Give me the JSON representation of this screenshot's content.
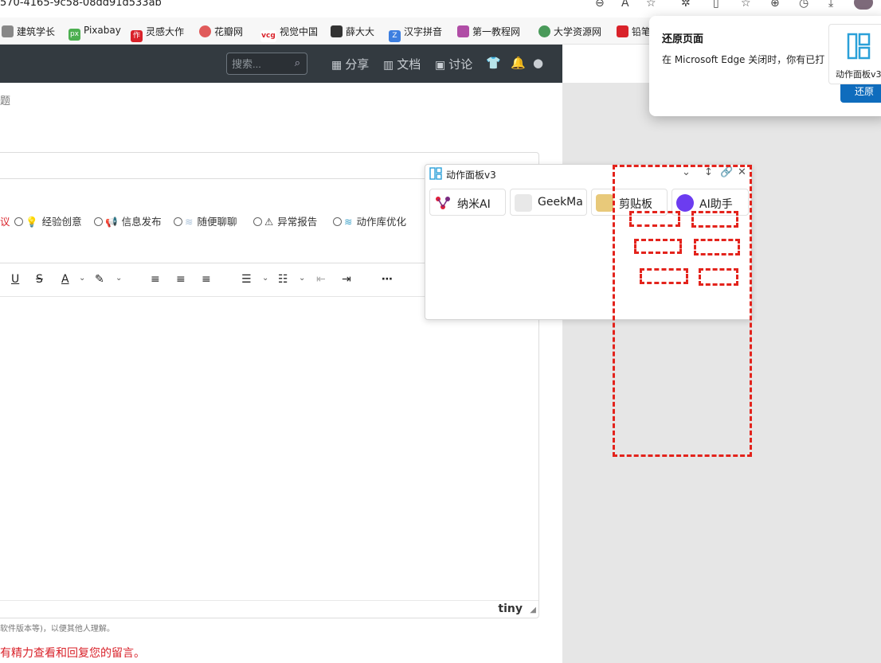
{
  "browser": {
    "url_fragment": "570-4165-9c58-08dd91d533ab",
    "favorites": [
      "建筑学长",
      "Pixabay",
      "灵感大作",
      "花瓣网",
      "视觉中国",
      "薛大大",
      "汉字拼音",
      "第一教程网",
      "大学资源网",
      "铅笔"
    ]
  },
  "navbar": {
    "search_placeholder": "搜索...",
    "items": [
      "分享",
      "文档",
      "讨论"
    ]
  },
  "form": {
    "title_label": "题",
    "categories": [
      "议",
      "经验创意",
      "信息发布",
      "随便聊聊",
      "异常报告",
      "动作库优化"
    ],
    "hint": "软件版本等)，以便其他人理解。",
    "warning": "有精力查看和回复您的留言。"
  },
  "editor": {
    "brand": "tiny"
  },
  "panel": {
    "title": "动作面板v3",
    "buttons": [
      "纳米AI",
      "GeekMa",
      "剪贴板",
      "AI助手"
    ]
  },
  "popup": {
    "title": "还原页面",
    "message": "在 Microsoft Edge 关闭时，你有已打",
    "restore_label": "还原",
    "tile_label": "动作面板v3"
  },
  "colors": {
    "navbar_bg": "#333a40",
    "annotation_red": "#e3231c",
    "edge_blue": "#0f6cbd"
  }
}
